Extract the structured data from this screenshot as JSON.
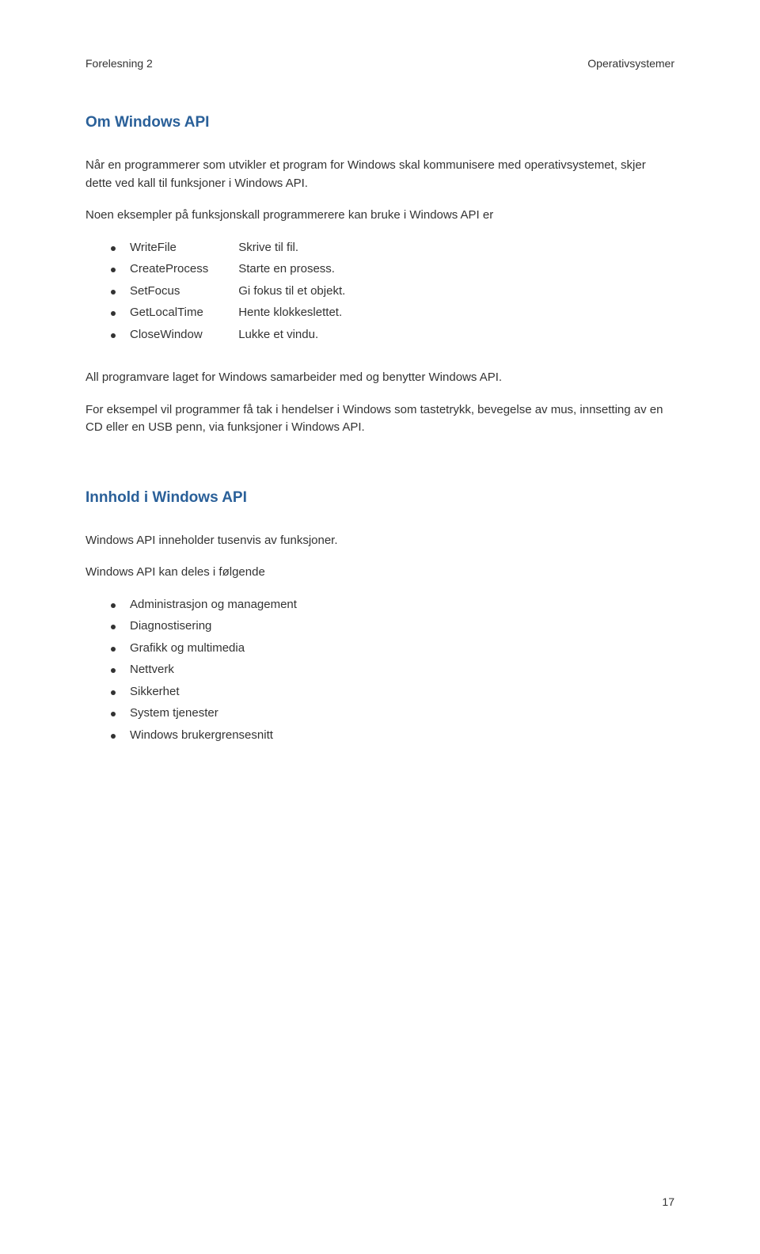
{
  "header": {
    "left": "Forelesning 2",
    "right": "Operativsystemer"
  },
  "sections": {
    "om_windows_api": {
      "title": "Om Windows API",
      "intro": "Når en programmerer som utvikler et program for Windows skal kommunisere med operativsystemet, skjer dette ved kall til funksjoner i Windows API.",
      "examples_intro": "Noen eksempler på funksjonskall programmerere kan bruke i Windows API er",
      "functions": [
        {
          "name": "WriteFile",
          "desc": "Skrive til fil."
        },
        {
          "name": "CreateProcess",
          "desc": "Starte en prosess."
        },
        {
          "name": "SetFocus",
          "desc": "Gi fokus til et objekt."
        },
        {
          "name": "GetLocalTime",
          "desc": "Hente klokkeslettet."
        },
        {
          "name": "CloseWindow",
          "desc": "Lukke et vindu."
        }
      ],
      "para1": "All programvare laget for Windows samarbeider med og benytter Windows API.",
      "para2": "For eksempel vil programmer få tak i hendelser i Windows som tastetrykk, bevegelse av mus, innsetting av en CD eller en USB penn, via funksjoner i Windows API."
    },
    "innhold": {
      "title": "Innhold i Windows API",
      "line1": "Windows API inneholder tusenvis av funksjoner.",
      "line2": "Windows API kan deles i følgende",
      "items": [
        "Administrasjon og management",
        "Diagnostisering",
        "Grafikk og multimedia",
        "Nettverk",
        "Sikkerhet",
        "System tjenester",
        "Windows brukergrensesnitt"
      ]
    }
  },
  "page_number": "17"
}
